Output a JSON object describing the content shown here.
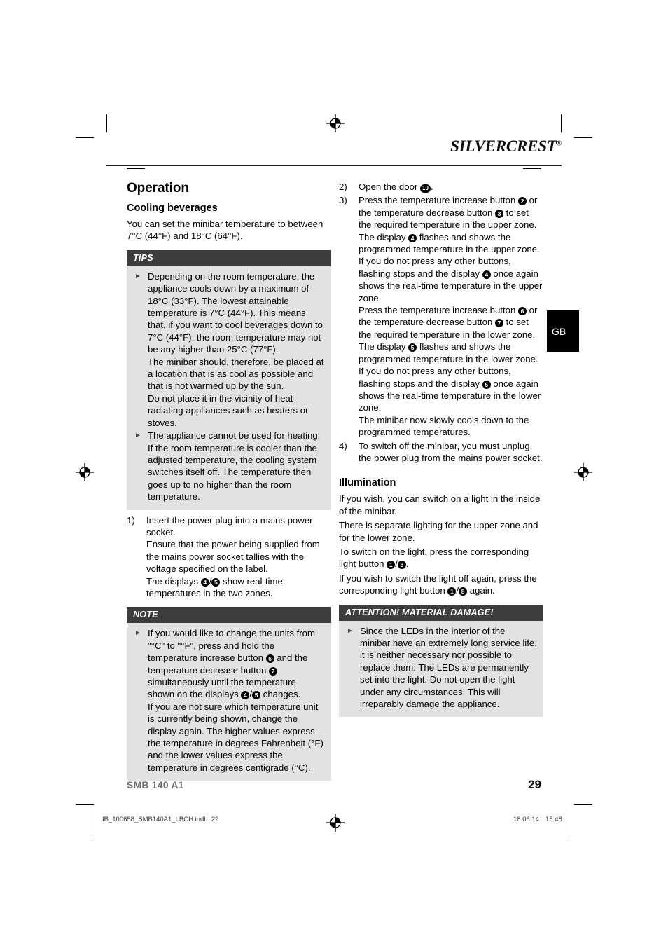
{
  "brand": {
    "logo_silver": "SILVER",
    "logo_crest": "CREST",
    "registered_mark": "®"
  },
  "language_tab": {
    "label": "GB"
  },
  "left_column": {
    "section_title": "Operation",
    "subsection_title": "Cooling beverages",
    "intro": "You can set the minibar temperature to between 7°C (44°F) and 18°C (64°F).",
    "tips_box": {
      "heading": "TIPS",
      "bullets": [
        "Depending on the room temperature, the appliance cools down by a maximum of 18°C (33°F). The lowest attainable temperature is 7°C (44°F). This means that, if you want to cool beverages down to 7°C (44°F), the room temperature may not be any higher than 25°C (77°F).\nThe minibar should, therefore, be placed at a location that is as cool as possible and that is not warmed up by the sun.\nDo not place it in the vicinity of heat-radiating appliances such as heaters or stoves.",
        "The appliance cannot be used for heating. If the room temperature is cooler than the adjusted temperature, the cooling system switches itself off. The temperature then goes up to no higher than the room temperature."
      ]
    },
    "step1": {
      "number": "1)",
      "text_a": "Insert the power plug into a mains power socket.",
      "text_b": "Ensure that the power being supplied from the mains power socket tallies with the voltage specified on the label.",
      "text_c_pre": "The displays ",
      "text_c_marker_a": "4",
      "text_c_sep": "/",
      "text_c_marker_b": "5",
      "text_c_post": " show real-time temperatures in the two zones."
    },
    "note_box": {
      "heading": "NOTE",
      "text_pre": "If you would like to change the units from \"°C\" to \"°F\", press and hold the temperature increase button ",
      "marker_a": "6",
      "text_mid": " and the temperature decrease button ",
      "marker_b": "7",
      "text_mid2": " simultaneously until the temperature shown on the displays ",
      "marker_c": "4",
      "sep": "/",
      "marker_d": "5",
      "text_post": " changes.\nIf you are not sure which temperature unit is currently being shown, change the display again. The higher values express the temperature in degrees Fahrenheit (°F) and the lower values express the temperature in degrees centigrade (°C)."
    }
  },
  "right_column": {
    "step2": {
      "number": "2)",
      "text_pre": "Open the door ",
      "marker": "10",
      "text_post": "."
    },
    "step3": {
      "number": "3)",
      "p1_pre": "Press the temperature increase button ",
      "p1_m1": "2",
      "p1_mid": " or the temperature decrease button ",
      "p1_m2": "3",
      "p1_post": " to set the required temperature in the upper zone.",
      "p2_pre": "The display ",
      "p2_m1": "4",
      "p2_mid": " flashes and shows the programmed temperature in the upper zone. If you do not press any other buttons, flashing stops and the display ",
      "p2_m2": "4",
      "p2_post": " once again shows the real-time temperature in the upper zone.",
      "p3_pre": "Press the temperature increase button ",
      "p3_m1": "6",
      "p3_mid": " or the temperature decrease button ",
      "p3_m2": "7",
      "p3_post": " to set the required temperature in the lower zone.",
      "p4_pre": "The display ",
      "p4_m1": "5",
      "p4_mid": " flashes and shows the programmed temperature in the lower zone. If you do not press any other buttons, flashing stops and the display ",
      "p4_m2": "5",
      "p4_post": " once again shows the real-time temperature in the lower zone.",
      "p5": "The minibar now slowly cools down to the programmed temperatures."
    },
    "step4": {
      "number": "4)",
      "text": "To switch off the minibar, you must unplug the power plug from the mains power socket."
    },
    "illumination_title": "Illumination",
    "illum_p1": "If you wish, you can switch on a light in the inside of the minibar.",
    "illum_p2": "There is separate lighting for the upper zone and for the lower zone.",
    "illum_p3_pre": "To switch on the light, press the corresponding light button ",
    "illum_p3_m1": "1",
    "illum_p3_sep": "/",
    "illum_p3_m2": "8",
    "illum_p3_post": ".",
    "illum_p4_pre": "If you wish to switch the light off again, press the corresponding light button ",
    "illum_p4_m1": "1",
    "illum_p4_sep": "/",
    "illum_p4_m2": "8",
    "illum_p4_post": " again.",
    "attention_box": {
      "heading": "ATTENTION! MATERIAL DAMAGE!",
      "bullet": "Since the LEDs in the interior of the minibar have an extremely long service life, it is neither necessary nor possible to replace them. The LEDs are permanently set into the light. Do not open the light under any circumstances! This will irreparably damage the appliance."
    }
  },
  "footer": {
    "model": "SMB 140 A1",
    "page_number": "29"
  },
  "print_slug": {
    "filename": "IB_100658_SMB140A1_LBCH.indb",
    "page": "29",
    "date": "18.06.14",
    "time": "15:48"
  },
  "bullet_glyph": "►"
}
